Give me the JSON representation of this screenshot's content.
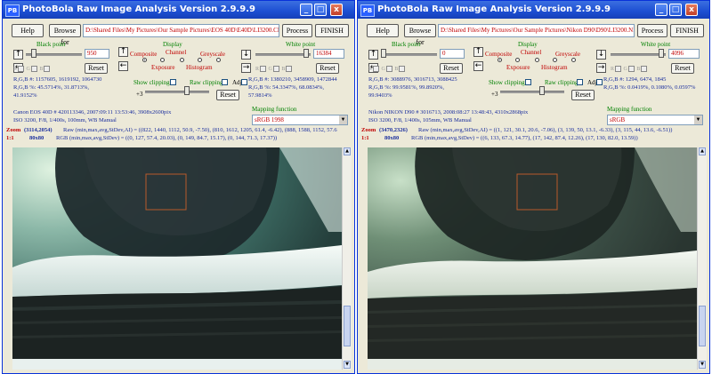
{
  "colors": {
    "title_bar": "#1c4ed2",
    "path_text": "#c00000",
    "label_green": "#008000",
    "label_red": "#c00000",
    "info_blue": "#1a2e9e",
    "overlay_box": "#b85a2a"
  },
  "windows": [
    {
      "app_icon": "PB",
      "title": "PhotoBola Raw Image Analysis Version 2.9.9.9",
      "controls": {
        "minimize": "_",
        "maximize": "□",
        "close": "x"
      },
      "help_label": "Help",
      "browse_label": "Browse for",
      "path": "D:\\Shared Files\\My Pictures\\Our Sample Pictures\\EOS 40D\\E40D\\LI3200.CR2",
      "process_label": "Process",
      "finish_label": "FINISH",
      "black_point": {
        "label": "Black point",
        "value": "950",
        "reset": "Reset",
        "rgb_labels": [
          "R",
          "G",
          "B"
        ],
        "level": 0.1
      },
      "white_point": {
        "label": "White point",
        "value": "16384",
        "reset": "Reset",
        "rgb_labels": [
          "R",
          "G",
          "B"
        ],
        "level": 0.95
      },
      "display": {
        "label": "Display",
        "composite": "Composite",
        "channel": "Channel",
        "greyscale": "Greyscale",
        "exposure": "Exposure",
        "histogram": "Histogram",
        "selected": "composite"
      },
      "black_rgb": {
        "line1": "R,G,B #: 1157605, 1619192, 1064730",
        "line2": "R,G,B %: 45.5714%, 31.8713%,",
        "line3": "41.9152%"
      },
      "white_rgb": {
        "line1": "R,G,B #: 1380210, 3458909, 1472844",
        "line2": "R,G,B %: 54.3347%, 68.0834%,",
        "line3": "57.9814%"
      },
      "show_clipping": "Show clipping",
      "raw_clipping": "Raw clipping",
      "adj_label": "Adj",
      "exposure_value": "+3",
      "exposure_reset": "Reset",
      "camera_info": {
        "line1": "Canon EOS 40D # 420113346,   2007:09:11 13:53:46,   3908x2600pix",
        "line2": "ISO 3200,  F/8,  1/400s,  100mm,  WB Manual"
      },
      "mapping": {
        "label": "Mapping function",
        "value": "sRGB 1998"
      },
      "zoom_label": "Zoom",
      "zoom_coords": "(3114,2054)",
      "zoom_raw": "Raw (min,max,avg,StDev,AI) = ((822, 1440, 1112, 50.9, -7.50), (810, 1612, 1205, 61.4, -6.42), (888, 1588, 1152, 57.6",
      "zoom_ratio": "1:1",
      "region": "80x80",
      "rgb_line": "RGB (min,max,avg,StDev) = ((0, 127, 57.4, 20.03), (0, 149, 84.7, 15.17), (0, 144, 71.3, 17.37))"
    },
    {
      "app_icon": "PB",
      "title": "PhotoBola Raw Image Analysis Version 2.9.9.9",
      "controls": {
        "minimize": "_",
        "maximize": "□",
        "close": "x"
      },
      "help_label": "Help",
      "browse_label": "Browse for",
      "path": "D:\\Shared Files\\My Pictures\\Our Sample Pictures\\Nikon D90\\D90\\LI3200.NEF",
      "process_label": "Process",
      "finish_label": "FINISH",
      "black_point": {
        "label": "Black point",
        "value": "0",
        "reset": "Reset",
        "rgb_labels": [
          "R",
          "G",
          "B"
        ],
        "level": 0.0
      },
      "white_point": {
        "label": "White point",
        "value": "4096",
        "reset": "Reset",
        "rgb_labels": [
          "R",
          "G",
          "B"
        ],
        "level": 0.95
      },
      "display": {
        "label": "Display",
        "composite": "Composite",
        "channel": "Channel",
        "greyscale": "Greyscale",
        "exposure": "Exposure",
        "histogram": "Histogram",
        "selected": "composite"
      },
      "black_rgb": {
        "line1": "R,G,B #: 3088976, 3016713, 3088425",
        "line2": "R,G,B %: 99.9581%, 99.8920%,",
        "line3": "99.9403%"
      },
      "white_rgb": {
        "line1": "R,G,B #: 1294, 6474, 1845",
        "line2": "R,G,B %: 0.0419%, 0.1080%, 0.0597%",
        "line3": ""
      },
      "show_clipping": "Show clipping",
      "raw_clipping": "Raw clipping",
      "adj_label": "Adj",
      "exposure_value": "+3",
      "exposure_reset": "Reset",
      "camera_info": {
        "line1": "Nikon NIKON D90 # 3016713,   2008:08:27 13:48:43,   4310x2868pix",
        "line2": "ISO 3200,  F/8,  1/400s,  105mm,  WB Manual"
      },
      "mapping": {
        "label": "Mapping function",
        "value": "sRGB"
      },
      "zoom_label": "Zoom",
      "zoom_coords": "(3470,2326)",
      "zoom_raw": "Raw (min,max,avg,StDev,AI) = ((1, 121, 30.1, 20.6, -7.06), (3, 139, 50, 13.1, -6.33), (3, 115, 44, 13.6, -6.51))",
      "zoom_ratio": "1:1",
      "region": "80x80",
      "rgb_line": "RGB (min,max,avg,StDev) = ((6, 133, 67.3, 14.77), (17, 142, 87.4, 12.26), (17, 130, 82.0, 13.59))"
    }
  ]
}
